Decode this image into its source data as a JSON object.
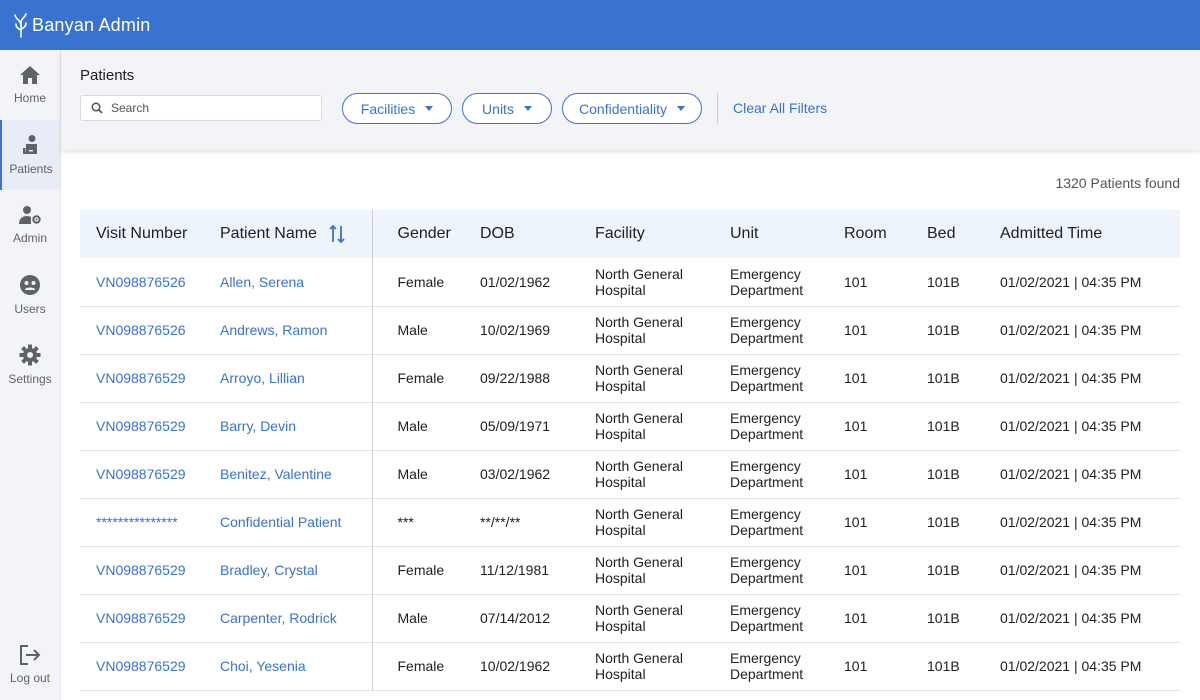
{
  "app": {
    "title": "Banyan Admin"
  },
  "sidebar": {
    "items": [
      {
        "label": "Home",
        "icon": "home-icon"
      },
      {
        "label": "Patients",
        "icon": "patient-icon",
        "active": true
      },
      {
        "label": "Admin",
        "icon": "admin-icon"
      },
      {
        "label": "Users",
        "icon": "users-icon"
      },
      {
        "label": "Settings",
        "icon": "gear-icon"
      }
    ],
    "logout": {
      "label": "Log out",
      "icon": "logout-icon"
    }
  },
  "filters": {
    "title": "Patients",
    "search_placeholder": "Search",
    "facilities": "Facilities",
    "units": "Units",
    "confidentiality": "Confidentiality",
    "clear_all": "Clear All Filters"
  },
  "results": {
    "count_text": "1320 Patients found"
  },
  "table": {
    "columns": [
      "Visit Number",
      "Patient Name",
      "Gender",
      "DOB",
      "Facility",
      "Unit",
      "Room",
      "Bed",
      "Admitted Time"
    ],
    "rows": [
      [
        "VN098876526",
        "Allen, Serena",
        "Female",
        "01/02/1962",
        "North General Hospital",
        "Emergency Department",
        "101",
        "101B",
        "01/02/2021 | 04:35 PM"
      ],
      [
        "VN098876526",
        "Andrews, Ramon",
        "Male",
        "10/02/1969",
        "North General Hospital",
        "Emergency Department",
        "101",
        "101B",
        "01/02/2021 | 04:35 PM"
      ],
      [
        "VN098876529",
        "Arroyo, Lillian",
        "Female",
        "09/22/1988",
        "North General Hospital",
        "Emergency Department",
        "101",
        "101B",
        "01/02/2021 | 04:35 PM"
      ],
      [
        "VN098876529",
        "Barry, Devin",
        "Male",
        "05/09/1971",
        "North General Hospital",
        "Emergency Department",
        "101",
        "101B",
        "01/02/2021 | 04:35 PM"
      ],
      [
        "VN098876529",
        "Benitez, Valentine",
        "Male",
        "03/02/1962",
        "North General Hospital",
        "Emergency Department",
        "101",
        "101B",
        "01/02/2021 | 04:35 PM"
      ],
      [
        "***************",
        "Confidential Patient",
        "***",
        "**/**/**",
        "North General Hospital",
        "Emergency Department",
        "101",
        "101B",
        "01/02/2021 | 04:35 PM"
      ],
      [
        "VN098876529",
        "Bradley, Crystal",
        "Female",
        "11/12/1981",
        "North General Hospital",
        "Emergency Department",
        "101",
        "101B",
        "01/02/2021 | 04:35 PM"
      ],
      [
        "VN098876529",
        "Carpenter, Rodrick",
        "Male",
        "07/14/2012",
        "North General Hospital",
        "Emergency Department",
        "101",
        "101B",
        "01/02/2021 | 04:35 PM"
      ],
      [
        "VN098876529",
        "Choi, Yesenia",
        "Female",
        "10/02/1962",
        "North General Hospital",
        "Emergency Department",
        "101",
        "101B",
        "01/02/2021 | 04:35 PM"
      ]
    ]
  },
  "colors": {
    "brand": "#3a72d0",
    "sidebar_bg": "#f3f4f7",
    "header_row_bg": "#eef4fb"
  }
}
